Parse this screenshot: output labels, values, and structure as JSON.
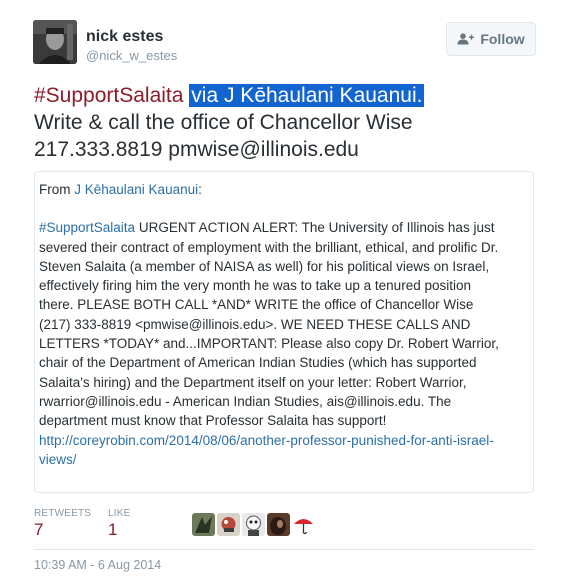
{
  "user": {
    "name": "nick estes",
    "handle": "@nick_w_estes",
    "follow_label": "Follow"
  },
  "tweet": {
    "hashtag": "#SupportSalaita",
    "selected_text": "via J Kēhaulani Kauanui.",
    "line2": "Write & call the office of Chancellor Wise",
    "line3": "217.333.8819 pmwise@illinois.edu"
  },
  "quote": {
    "from_prefix": "From ",
    "from_name": "J Kēhaulani Kauanui",
    "from_suffix": ":",
    "hashtag": "#SupportSalaita",
    "line1_rest": " URGENT ACTION ALERT: The University of Illinois has just",
    "lines": [
      "severed their contract of employment with the brilliant, ethical, and prolific Dr.",
      "Steven Salaita (a member of NAISA as well) for his political views on Israel,",
      "effectively firing him the very month he was to take up a tenured position",
      "there. PLEASE BOTH CALL *AND* WRITE the office of Chancellor Wise",
      "(217) 333-8819 <pmwise@illinois.edu>. WE NEED THESE CALLS AND",
      "LETTERS *TODAY* and...IMPORTANT: Please also copy Dr. Robert Warrior,",
      "chair of the Department of American Indian Studies (which has supported",
      "Salaita's hiring) and the Department itself on your letter: Robert Warrior,",
      "rwarrior@illinois.edu - American Indian Studies, ais@illinois.edu. The",
      "department must know that Professor Salaita has support!"
    ],
    "link_lines": [
      "http://coreyrobin.com/2014/08/06/another-professor-punished-for-anti-israel-",
      "views/"
    ]
  },
  "stats": {
    "retweets_label": "RETWEETS",
    "retweets_count": "7",
    "likes_label": "LIKE",
    "likes_count": "1"
  },
  "timestamp": "10:39 AM - 6 Aug 2014",
  "icons": {
    "follow": "person-plus-icon"
  },
  "colors": {
    "accent": "#8b1c2c",
    "link": "#2b6fa6",
    "selection": "#1264d1",
    "muted": "#8899a6"
  }
}
